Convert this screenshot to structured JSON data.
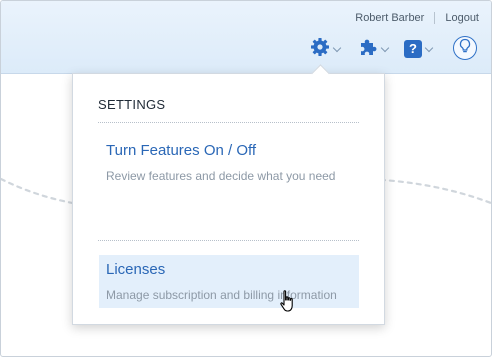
{
  "header": {
    "user_name": "Robert Barber",
    "logout_label": "Logout",
    "icons": [
      "gear-icon",
      "puzzle-icon",
      "help-icon",
      "lightbulb-icon"
    ],
    "help_glyph": "?"
  },
  "dropdown": {
    "title": "SETTINGS",
    "items": [
      {
        "label": "Turn Features On / Off",
        "description": "Review features and decide what you need",
        "hovered": false
      },
      {
        "label": "Licenses",
        "description": "Manage subscription and billing information",
        "hovered": true
      }
    ]
  },
  "colors": {
    "accent": "#2a67b6",
    "topbar": "#dcebf9",
    "hover_row": "#e3effb"
  }
}
